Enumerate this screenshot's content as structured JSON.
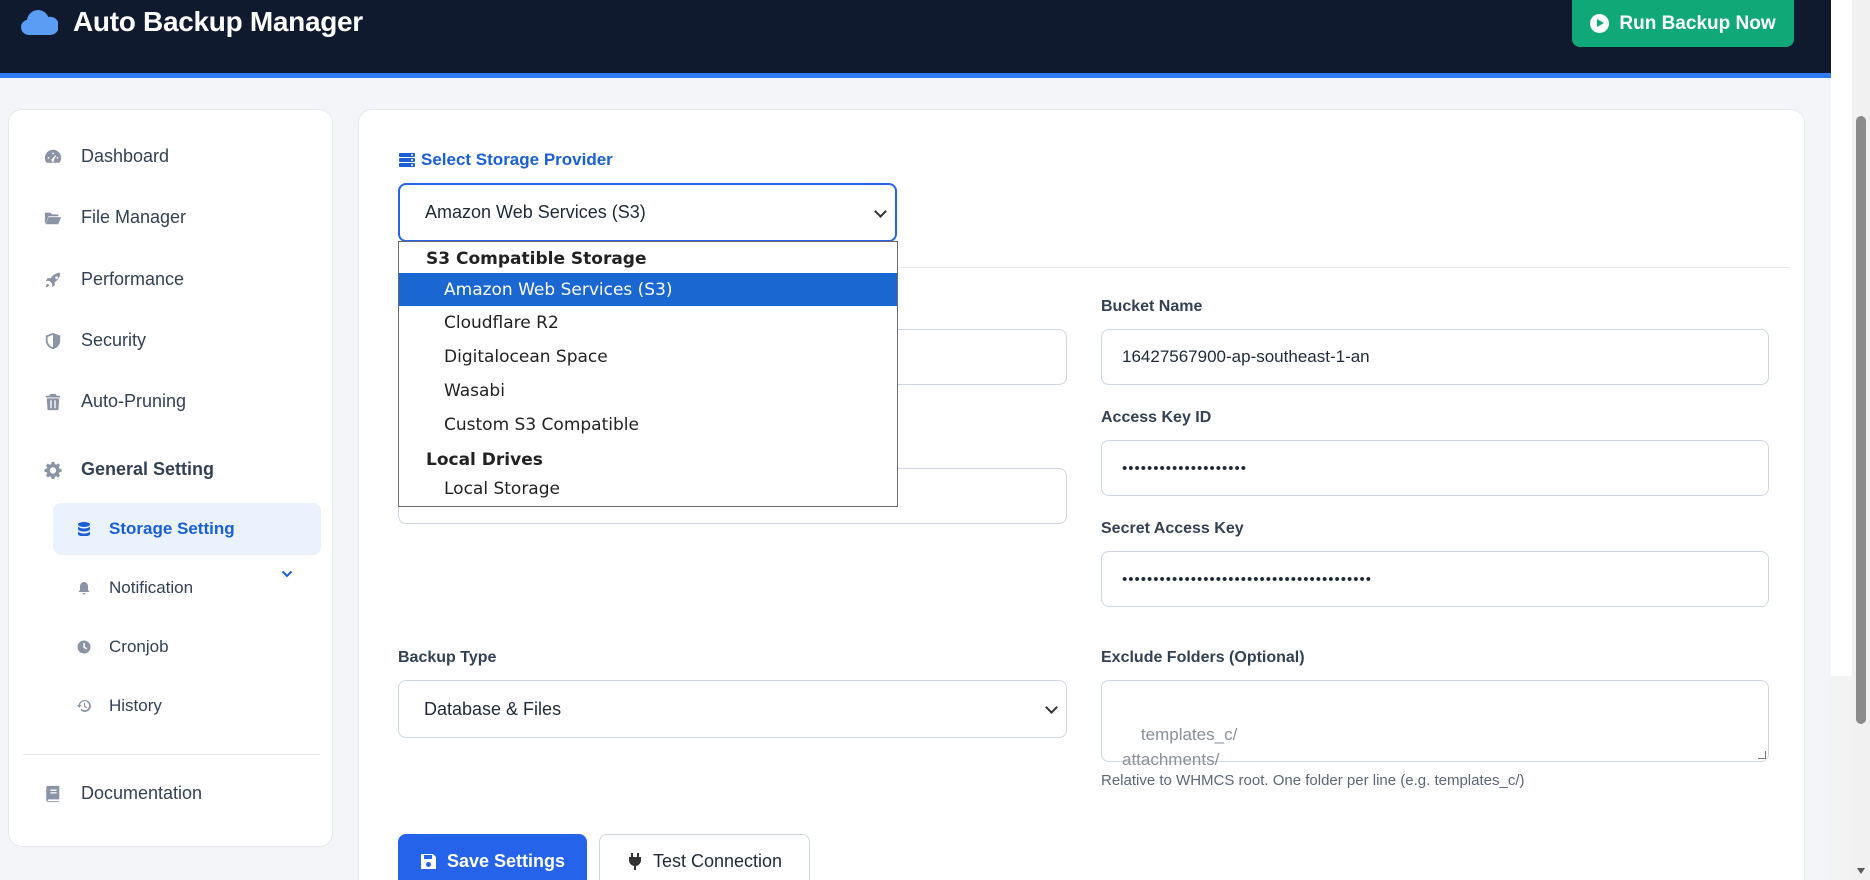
{
  "header": {
    "title": "Auto Backup Manager",
    "run_button": "Run Backup Now"
  },
  "sidebar": {
    "items": [
      {
        "label": "Dashboard",
        "icon": "gauge-icon"
      },
      {
        "label": "File Manager",
        "icon": "folder-open-icon"
      },
      {
        "label": "Performance",
        "icon": "rocket-icon"
      },
      {
        "label": "Security",
        "icon": "shield-icon"
      },
      {
        "label": "Auto-Pruning",
        "icon": "trash-icon"
      }
    ],
    "general": {
      "label": "General Setting",
      "icon": "gear-icon"
    },
    "subitems": [
      {
        "label": "Storage Setting",
        "icon": "database-icon",
        "active": true
      },
      {
        "label": "Notification",
        "icon": "bell-icon"
      },
      {
        "label": "Cronjob",
        "icon": "clock-icon"
      },
      {
        "label": "History",
        "icon": "history-icon"
      }
    ],
    "documentation": {
      "label": "Documentation",
      "icon": "book-icon"
    }
  },
  "main": {
    "provider_label": "Select Storage Provider",
    "provider_value": "Amazon Web Services (S3)",
    "bucket_label": "Bucket Name",
    "bucket_value": "16427567900-ap-southeast-1-an",
    "access_key_label": "Access Key ID",
    "access_key_value": "••••••••••••••••••••",
    "secret_key_label": "Secret Access Key",
    "secret_key_value": "••••••••••••••••••••••••••••••••••••••••",
    "backup_type_label": "Backup Type",
    "backup_type_value": "Database & Files",
    "exclude_label": "Exclude Folders (Optional)",
    "exclude_placeholder": "templates_c/\nattachments/",
    "exclude_hint": "Relative to WHMCS root. One folder per line (e.g. templates_c/)",
    "save_button": "Save Settings",
    "test_button": "Test Connection"
  },
  "dropdown": {
    "groups": [
      {
        "label": "S3 Compatible Storage",
        "options": [
          "Amazon Web Services (S3)",
          "Cloudflare R2",
          "Digitalocean Space",
          "Wasabi",
          "Custom S3 Compatible"
        ]
      },
      {
        "label": "Local Drives",
        "options": [
          "Local Storage"
        ]
      }
    ],
    "selected": "Amazon Web Services (S3)"
  },
  "colors": {
    "header_bg": "#0f1a2e",
    "accent": "#2563eb",
    "success": "#10a877"
  }
}
